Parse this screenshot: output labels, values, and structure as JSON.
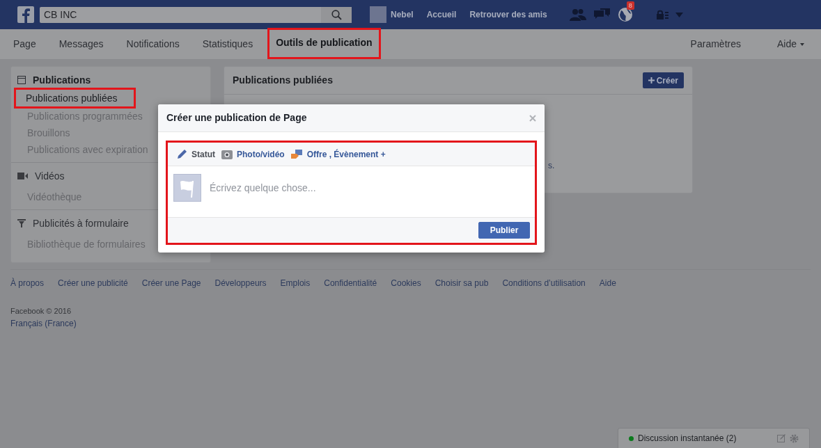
{
  "topbar": {
    "search": {
      "value": "CB INC"
    },
    "user": "Nebel",
    "links": [
      "Accueil",
      "Retrouver des amis"
    ],
    "notification_badge": "8"
  },
  "tabs": [
    {
      "label": "Page",
      "selected": false,
      "annotated": false
    },
    {
      "label": "Messages",
      "selected": false,
      "annotated": false
    },
    {
      "label": "Notifications",
      "selected": false,
      "annotated": false
    },
    {
      "label": "Statistiques",
      "selected": false,
      "annotated": false
    },
    {
      "label": "Outils de publication",
      "selected": true,
      "annotated": true
    }
  ],
  "tabs_right": [
    {
      "label": "Paramètres",
      "kind": "link"
    },
    {
      "label": "Aide",
      "kind": "dropdown"
    }
  ],
  "sidebar": [
    {
      "title": "Publications",
      "kind": "calendar",
      "items": [
        {
          "label": "Publications publiées",
          "selected": true,
          "annotated": true
        },
        {
          "label": "Publications programmées",
          "selected": false,
          "annotated": false
        },
        {
          "label": "Brouillons",
          "selected": false,
          "annotated": false
        },
        {
          "label": "Publications avec expiration",
          "selected": false,
          "annotated": false
        }
      ]
    },
    {
      "title": "Vidéos",
      "kind": "video",
      "items": [
        {
          "label": "Vidéothèque",
          "selected": false,
          "annotated": false
        }
      ]
    },
    {
      "title": "Publicités à formulaire",
      "kind": "filter",
      "items": [
        {
          "label": "Bibliothèque de formulaires",
          "selected": false,
          "annotated": false
        }
      ]
    }
  ],
  "main_card": {
    "title": "Publications publiées",
    "button": "Créer",
    "body_fragment": "s."
  },
  "footer": {
    "links": [
      "À propos",
      "Créer une publicité",
      "Créer une Page",
      "Développeurs",
      "Emplois",
      "Confidentialité",
      "Cookies",
      "Choisir sa pub",
      "Conditions d’utilisation",
      "Aide"
    ],
    "copyright": "Facebook © 2016",
    "language": "Français (France)"
  },
  "modal": {
    "title": "Créer une publication de Page",
    "annotated": true,
    "composer_tabs": [
      {
        "label": "Statut",
        "kind": "status",
        "selected": true
      },
      {
        "label": "Photo/vidéo",
        "kind": "photo",
        "selected": false
      },
      {
        "label": "Offre , Évènement +",
        "kind": "offer",
        "selected": false
      }
    ],
    "placeholder": "Écrivez quelque chose...",
    "submit": "Publier"
  },
  "chat": {
    "label": "Discussion instantanée (2)",
    "online": true
  }
}
